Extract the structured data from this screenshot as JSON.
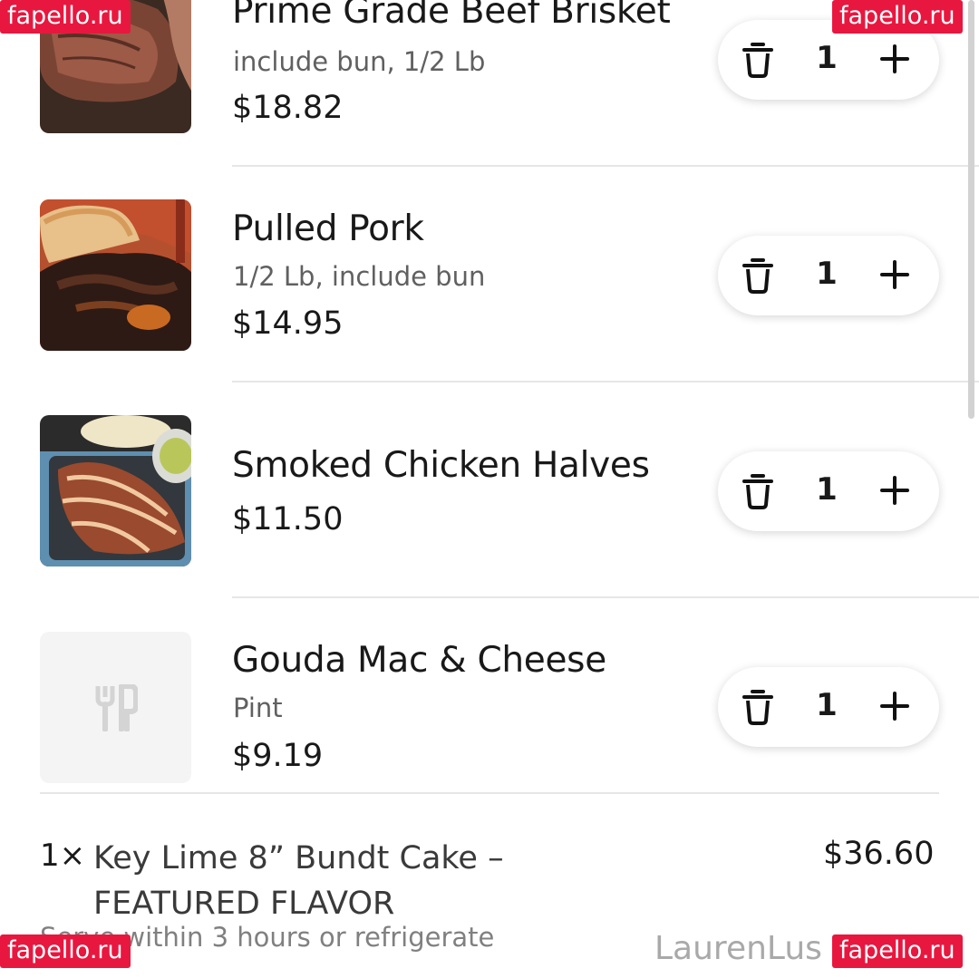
{
  "cart": {
    "items": [
      {
        "name": "Prime Grade Beef Brisket",
        "options": "include bun, 1/2 Lb",
        "price": "$18.82",
        "quantity": "1"
      },
      {
        "name": "Pulled Pork",
        "options": "1/2 Lb, include bun",
        "price": "$14.95",
        "quantity": "1"
      },
      {
        "name": "Smoked Chicken Halves",
        "price": "$11.50",
        "quantity": "1"
      },
      {
        "name": "Gouda Mac & Cheese",
        "options": "Pint",
        "price": "$9.19",
        "quantity": "1"
      }
    ],
    "summary_item": {
      "quantity": "1×",
      "name": "Key Lime 8” Bundt Cake – FEATURED FLAVOR",
      "price": "$36.60",
      "note": "Serve within 3 hours or refrigerate"
    }
  },
  "icons": {
    "delete": "trash-icon",
    "increase": "plus-icon",
    "placeholder": "utensils-icon"
  },
  "watermark": {
    "text": "fapello.ru",
    "color": "#e8173f"
  },
  "handle": "LaurenLus"
}
